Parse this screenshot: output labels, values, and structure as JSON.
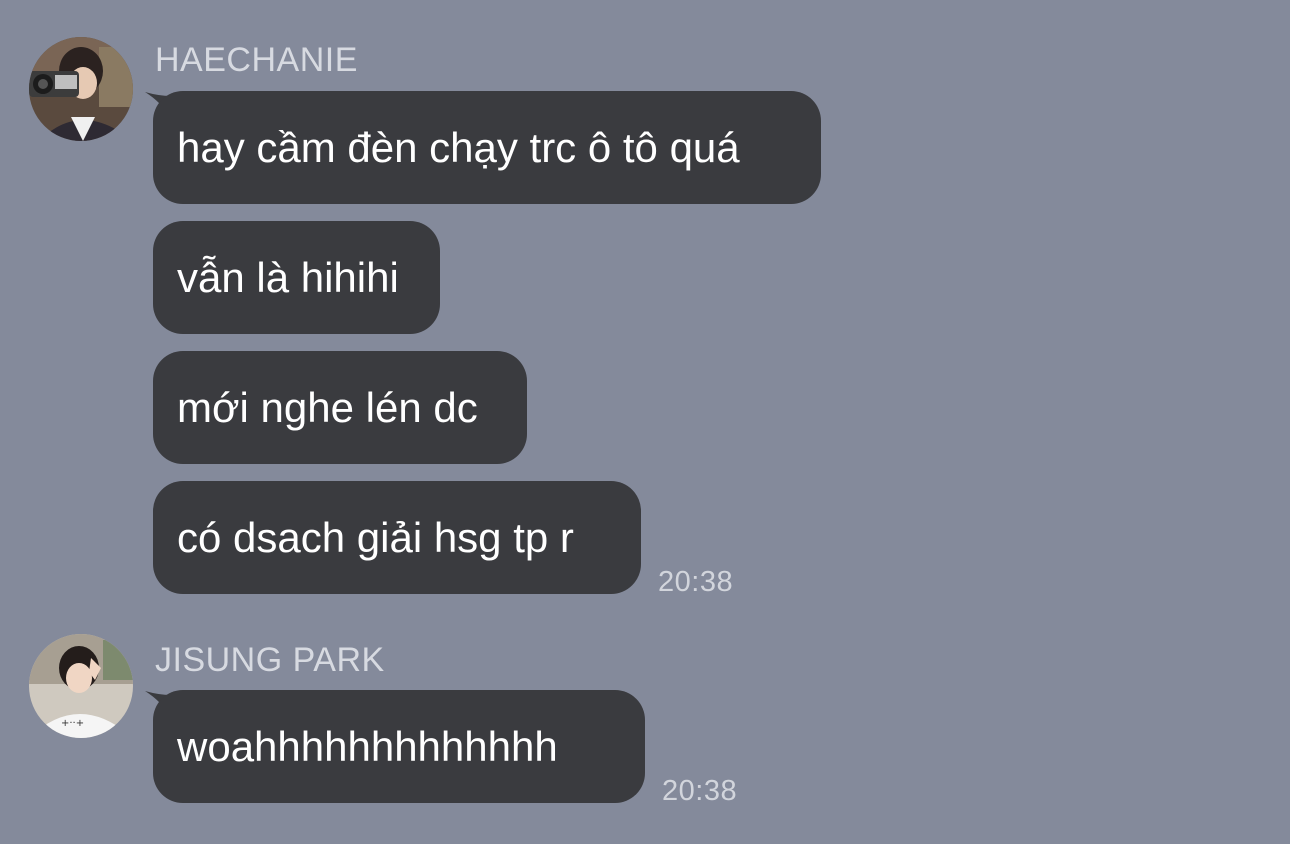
{
  "conversation": {
    "groups": [
      {
        "sender": "HAECHANIE",
        "avatar": "user-avatar-photo",
        "messages": [
          "hay cầm đèn chạy trc ô tô quá",
          "vẫn là hihihi",
          "mới nghe lén dc",
          "có dsach giải hsg tp r"
        ],
        "time": "20:38"
      },
      {
        "sender": "JISUNG PARK",
        "avatar": "user-avatar-photo",
        "messages": [
          "woahhhhhhhhhhhhh"
        ],
        "time": "20:38"
      }
    ]
  },
  "colors": {
    "background": "#848a9b",
    "bubble": "#3a3b3f",
    "text": "#ffffff",
    "meta": "#d7dae1"
  }
}
